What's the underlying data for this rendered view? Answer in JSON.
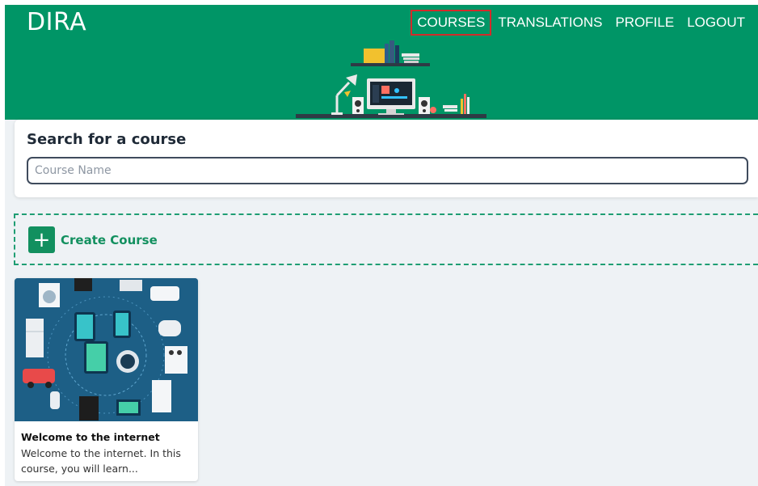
{
  "header": {
    "logo_text": "DIRA",
    "nav": [
      {
        "label": "COURSES",
        "active": true
      },
      {
        "label": "TRANSLATIONS",
        "active": false
      },
      {
        "label": "PROFILE",
        "active": false
      },
      {
        "label": "LOGOUT",
        "active": false
      }
    ]
  },
  "search": {
    "title": "Search for a course",
    "placeholder": "Course Name",
    "value": ""
  },
  "create_course": {
    "label": "Create Course",
    "icon": "plus-icon"
  },
  "courses": [
    {
      "title": "Welcome to the internet",
      "description": "Welcome to the internet. In this course, you will learn..."
    }
  ],
  "colors": {
    "brand_green": "#009566",
    "accent_green": "#12905f",
    "active_outline": "#d42a2a",
    "page_bg": "#eef2f5"
  }
}
